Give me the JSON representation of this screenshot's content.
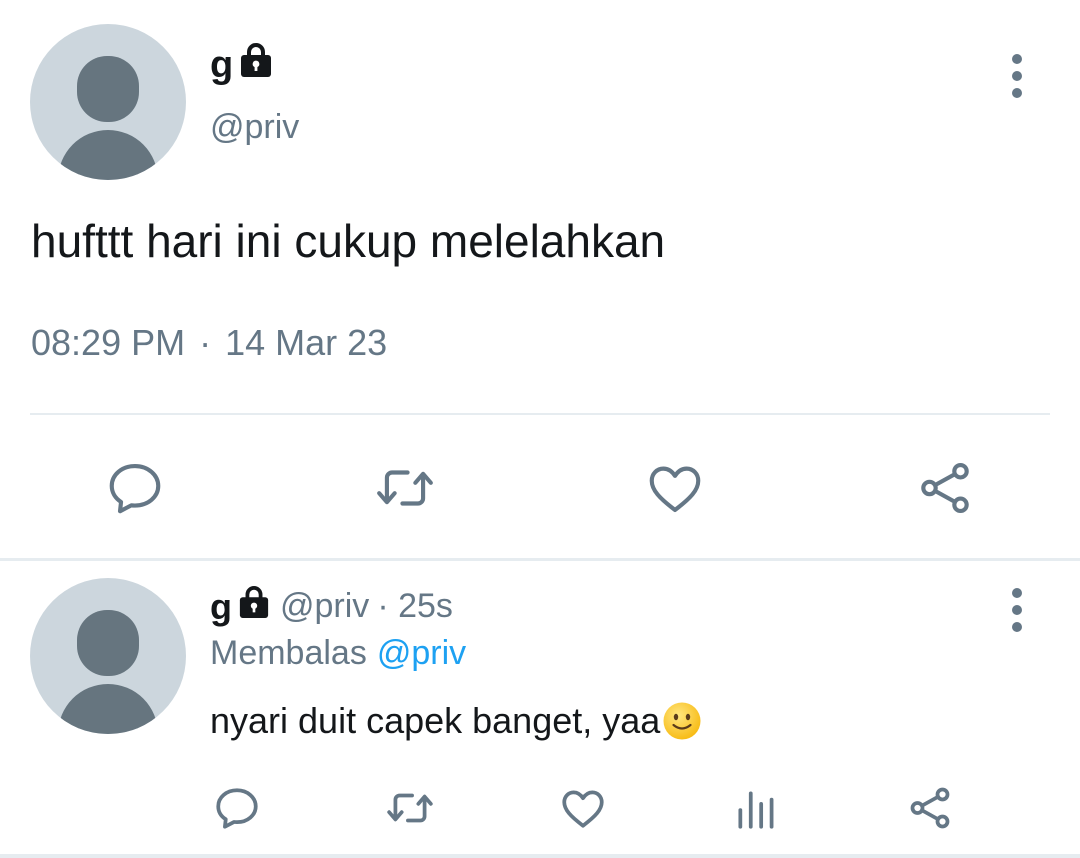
{
  "main_tweet": {
    "display_name": "g",
    "handle": "@priv",
    "text": "hufttt hari ini cukup melelahkan",
    "time": "08:29 PM",
    "separator": "·",
    "date": "14 Mar 23",
    "locked": true,
    "actions": [
      "reply-icon",
      "retweet-icon",
      "like-icon",
      "share-icon"
    ]
  },
  "reply_tweet": {
    "display_name": "g",
    "handle": "@priv",
    "time": "· 25s",
    "replying_label": "Membalas",
    "replying_to": "@priv",
    "text": "nyari duit capek banget, yaa",
    "emoji": "slightly-smiling-face",
    "locked": true,
    "actions": [
      "reply-icon",
      "retweet-icon",
      "like-icon",
      "stats-icon",
      "share-icon"
    ]
  },
  "colors": {
    "text": "#14171a",
    "secondary": "#657786",
    "link": "#1da1f2",
    "divider": "#e6ecf0",
    "avatar_bg": "#ccd6dd",
    "avatar_fg": "#66757f"
  }
}
